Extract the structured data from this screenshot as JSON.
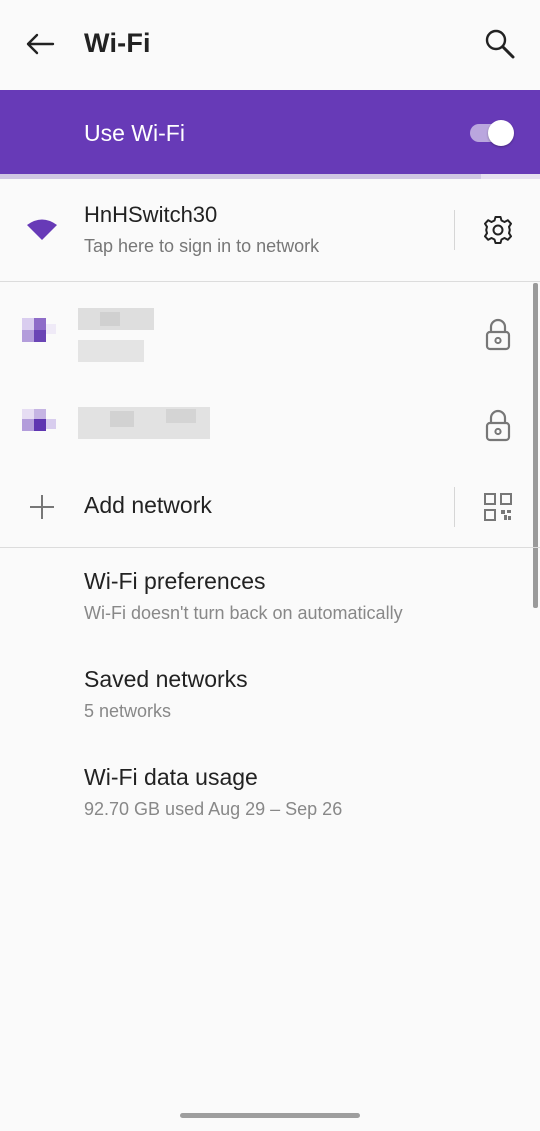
{
  "toolbar": {
    "title": "Wi-Fi"
  },
  "use_wifi": {
    "label": "Use Wi-Fi",
    "enabled": true,
    "accent": "#673ab7"
  },
  "progress": {
    "fraction": 0.89
  },
  "connected_network": {
    "name": "HnHSwitch30",
    "status": "Tap here to sign in to network"
  },
  "other_networks": [
    {
      "name": "",
      "detail": "",
      "secured": true
    },
    {
      "name": "",
      "detail": "",
      "secured": true
    }
  ],
  "add_network": {
    "label": "Add network"
  },
  "preferences": [
    {
      "title": "Wi-Fi preferences",
      "subtitle": "Wi-Fi doesn't turn back on automatically"
    },
    {
      "title": "Saved networks",
      "subtitle": "5 networks"
    },
    {
      "title": "Wi-Fi data usage",
      "subtitle": "92.70 GB used Aug 29 – Sep 26"
    }
  ],
  "icons": [
    "back-arrow-icon",
    "search-icon",
    "wifi-signal-icon",
    "gear-icon",
    "lock-icon",
    "plus-icon",
    "qr-code-icon"
  ]
}
